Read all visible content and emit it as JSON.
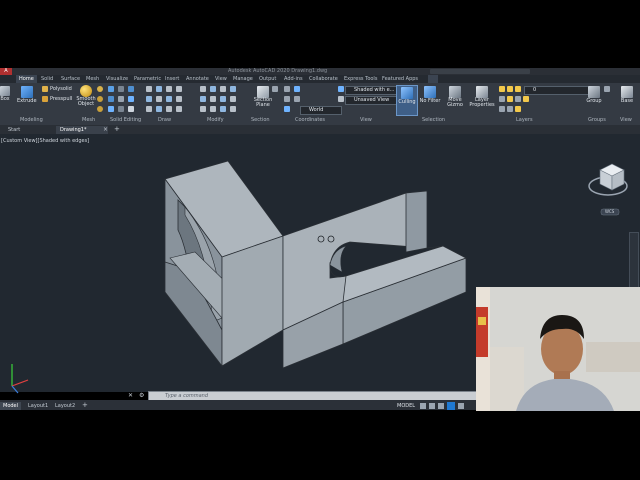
{
  "app": {
    "title": "Autodesk AutoCAD 2020  Drawing1.dwg",
    "icon_letter": "A"
  },
  "ribbon_tabs": [
    {
      "label": "Home",
      "active": true
    },
    {
      "label": "Solid"
    },
    {
      "label": "Surface"
    },
    {
      "label": "Mesh"
    },
    {
      "label": "Visualize"
    },
    {
      "label": "Parametric"
    },
    {
      "label": "Insert"
    },
    {
      "label": "Annotate"
    },
    {
      "label": "View"
    },
    {
      "label": "Manage"
    },
    {
      "label": "Output"
    },
    {
      "label": "Add-ins"
    },
    {
      "label": "Collaborate"
    },
    {
      "label": "Express Tools"
    },
    {
      "label": "Featured Apps"
    }
  ],
  "ribbon": {
    "box": "Box",
    "extrude": "Extrude",
    "polysolid": "Polysolid",
    "presspull": "Presspull",
    "smooth_object": "Smooth Object",
    "section_plane": "Section Plane",
    "visual_style": "Shaded with e...",
    "view": "Unsaved View",
    "ucs": "World",
    "culling": "Culling",
    "no_filter": "No Filter",
    "move_gizmo": "Move Gizmo",
    "layer_properties": "Layer Properties",
    "layer_name": "0",
    "group": "Group",
    "base": "Base"
  },
  "panels": {
    "modeling": "Modeling",
    "mesh": "Mesh",
    "solid_editing": "Solid Editing",
    "draw": "Draw",
    "modify": "Modify",
    "section": "Section",
    "coordinates": "Coordinates",
    "view": "View",
    "selection": "Selection",
    "layers": "Layers",
    "groups": "Groups",
    "view2": "View"
  },
  "doc_tabs": {
    "start": "Start",
    "drawing": "Drawing1*"
  },
  "viewport": {
    "label": "[Custom View][Shaded with edges]",
    "viewcube_label": "WCS"
  },
  "command_line": {
    "placeholder": "Type a command"
  },
  "status": {
    "model_tab": "Model",
    "layout1": "Layout1",
    "layout2": "Layout2",
    "model_label": "MODEL"
  },
  "colors": {
    "viewport_bg": "#212830",
    "ribbon_bg": "#343a43",
    "active_tab": "#3b4451",
    "accent": "#1f78d1"
  }
}
